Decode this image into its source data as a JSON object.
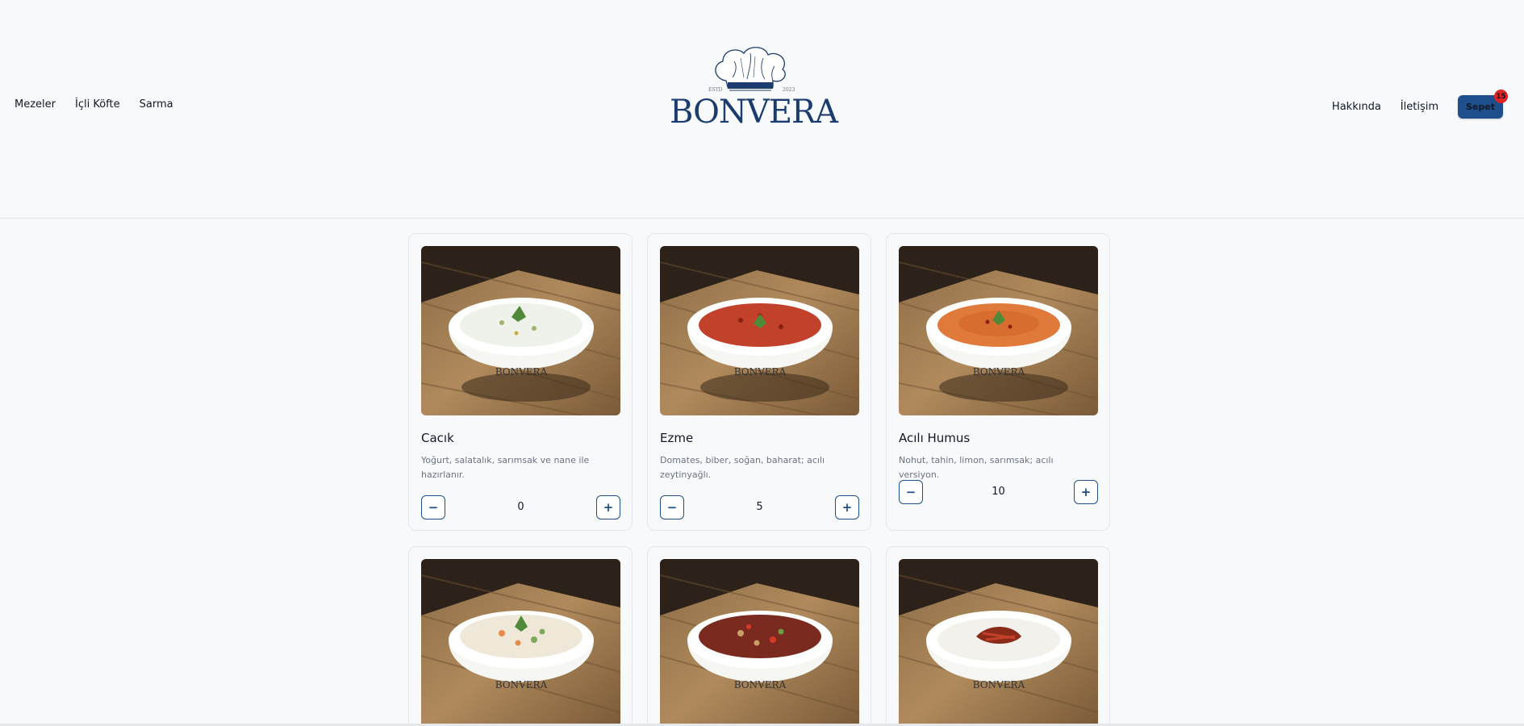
{
  "nav": {
    "left": [
      "Mezeler",
      "İçli Köfte",
      "Sarma"
    ],
    "right": [
      "Hakkında",
      "İletişim"
    ],
    "cart_label": "Sepet",
    "cart_count": "15"
  },
  "logo": {
    "word": "BONVERA",
    "estd": "ESTD",
    "year": "2023"
  },
  "products": [
    {
      "name": "Cacık",
      "desc": "Yoğurt, salatalık, sarımsak ve nane ile hazırlanır.",
      "qty": "0",
      "dish": "cacik"
    },
    {
      "name": "Ezme",
      "desc": "Domates, biber, soğan, baharat; acılı zeytinyağlı.",
      "qty": "5",
      "dish": "ezme"
    },
    {
      "name": "Acılı Humus",
      "desc": "Nohut, tahin, limon, sarımsak; acılı versiyon.",
      "qty": "10",
      "dish": "humus"
    },
    {
      "name": "",
      "desc": "",
      "qty": "",
      "dish": "salad"
    },
    {
      "name": "",
      "desc": "",
      "qty": "",
      "dish": "beans"
    },
    {
      "name": "",
      "desc": "",
      "qty": "",
      "dish": "yogurt-pepper"
    }
  ],
  "colors": {
    "accent": "#1f4e8c",
    "badge": "#e02424"
  },
  "icons": {
    "minus": "minus-icon",
    "plus": "plus-icon"
  }
}
